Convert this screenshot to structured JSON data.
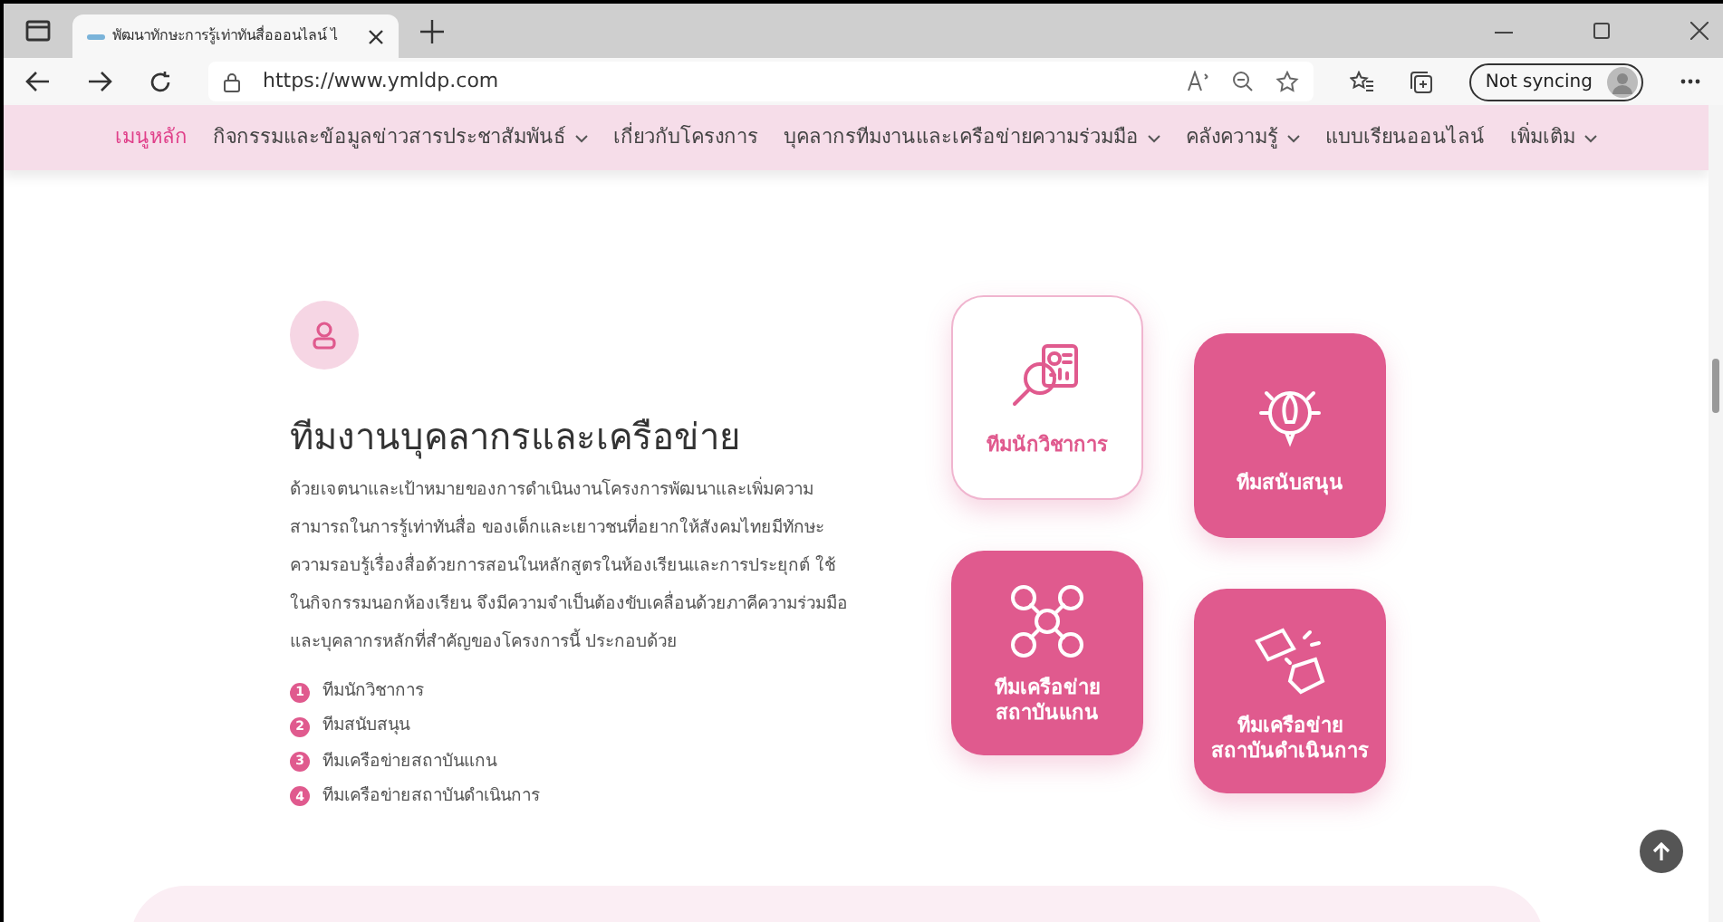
{
  "browser": {
    "tab_title": "พัฒนาทักษะการรู้เท่าทันสื่อออนไลน์ ไ",
    "url": "https://www.ymldp.com",
    "sync_label": "Not syncing"
  },
  "nav": [
    {
      "label": "เมนูหลัก",
      "selected": true,
      "dropdown": false
    },
    {
      "label": "กิจกรรมและข้อมูลข่าวสารประชาสัมพันธ์",
      "selected": false,
      "dropdown": true
    },
    {
      "label": "เกี่ยวกับโครงการ",
      "selected": false,
      "dropdown": false
    },
    {
      "label": "บุคลากรทีมงานและเครือข่ายความร่วมมือ",
      "selected": false,
      "dropdown": true
    },
    {
      "label": "คลังความรู้",
      "selected": false,
      "dropdown": true
    },
    {
      "label": "แบบเรียนออนไลน์",
      "selected": false,
      "dropdown": false
    },
    {
      "label": "เพิ่มเติม",
      "selected": false,
      "dropdown": true
    }
  ],
  "section": {
    "heading": "ทีมงานบุคลากรและเครือข่าย",
    "paragraph": "ด้วยเจตนาและเป้าหมายของการดำเนินงานโครงการพัฒนาและเพิ่มความสามารถในการรู้เท่าทันสื่อ ของเด็กและเยาวชนที่อยากให้สังคมไทยมีทักษะความรอบรู้เรื่องสื่อด้วยการสอนในหลักสูตรในห้องเรียนและการประยุกต์ ใช้ในกิจกรรมนอกห้องเรียน จึงมีความจำเป็นต้องขับเคลื่อนด้วยภาคีความร่วมมือและบุคลากรหลักที่สำคัญของโครงการนี้ ประกอบด้วย",
    "list": [
      {
        "number": "1",
        "label": "ทีมนักวิชาการ"
      },
      {
        "number": "2",
        "label": "ทีมสนับสนุน"
      },
      {
        "number": "3",
        "label": "ทีมเครือข่ายสถาบันแกน"
      },
      {
        "number": "4",
        "label": "ทีมเครือข่ายสถาบันดำเนินการ"
      }
    ]
  },
  "cards": [
    {
      "kind": "research",
      "lines": [
        "ทีมนักวิชาการ"
      ],
      "selected": true
    },
    {
      "kind": "rocket",
      "lines": [
        "ทีมสนับสนุน"
      ],
      "selected": false
    },
    {
      "kind": "network",
      "lines": [
        "ทีมเครือข่าย",
        "สถาบันแกน"
      ],
      "selected": false
    },
    {
      "kind": "fists",
      "lines": [
        "ทีมเครือข่าย",
        "สถาบันดำเนินการ"
      ],
      "selected": false
    }
  ]
}
